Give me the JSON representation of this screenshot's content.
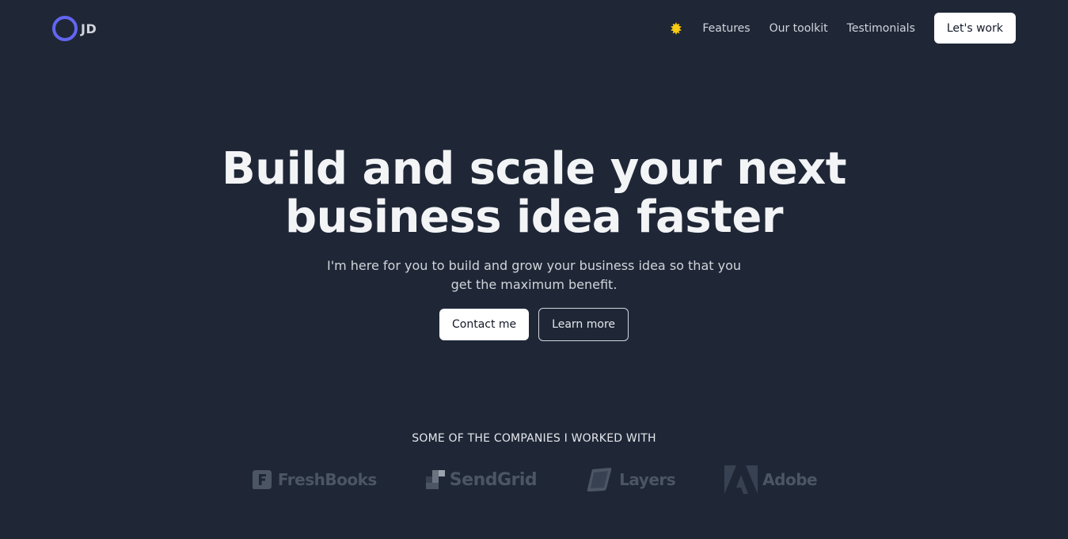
{
  "header": {
    "logo_text": "JD",
    "nav": [
      {
        "label": "Features"
      },
      {
        "label": "Our toolkit"
      },
      {
        "label": "Testimonials"
      }
    ],
    "cta_label": "Let's work"
  },
  "hero": {
    "title_line1": "Build and scale your next",
    "title_line2": "business idea faster",
    "subtitle": "I'm here for you to build and grow your business idea so that you get the maximum benefit.",
    "primary_button": "Contact me",
    "secondary_button": "Learn more"
  },
  "companies": {
    "heading": "SOME OF THE COMPANIES I WORKED WITH",
    "logos": [
      {
        "name": "FreshBooks",
        "icon": "freshbooks-logo"
      },
      {
        "name": "SendGrid",
        "icon": "sendgrid-logo"
      },
      {
        "name": "Layers",
        "icon": "layers-logo"
      },
      {
        "name": "Adobe",
        "icon": "adobe-logo"
      }
    ]
  },
  "colors": {
    "background": "#1f2737",
    "accent": "#6366f1",
    "sun": "#facc15",
    "logo_gray": "#4b5563"
  }
}
